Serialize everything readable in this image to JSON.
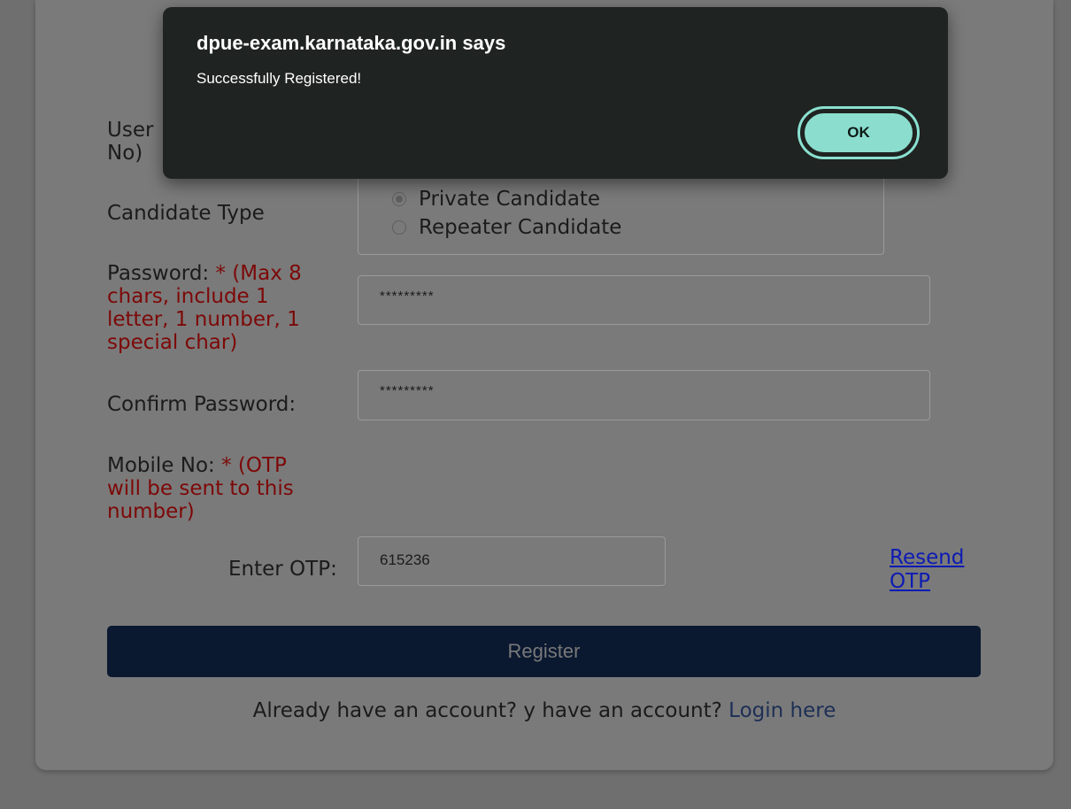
{
  "dialog": {
    "title": "dpue-exam.karnataka.gov.in says",
    "message": "Successfully Registered!",
    "ok_label": "OK"
  },
  "form": {
    "user_label_line1": "User",
    "user_label_line2": "No)",
    "candidate_type_label": "Candidate Type",
    "candidate_options": [
      {
        "label": "Private Candidate",
        "selected": true
      },
      {
        "label": "Repeater Candidate",
        "selected": false
      }
    ],
    "password_label": "Password:",
    "password_hint_line1": "* (Max 8",
    "password_hint_line2": "chars, include 1",
    "password_hint_line3": "letter, 1 number, 1",
    "password_hint_line4": "special char)",
    "password_value": "*********",
    "confirm_password_label": "Confirm Password:",
    "confirm_password_value": "*********",
    "mobile_label": "Mobile No:",
    "mobile_hint_line1": "* (OTP",
    "mobile_hint_line2": "will be sent to this",
    "mobile_hint_line3": "number)",
    "otp_label": "Enter OTP:",
    "otp_value": "615236",
    "resend_line1": "Resend",
    "resend_line2": "OTP",
    "register_label": "Register",
    "footer_text": "Already have an account? y have an account?",
    "login_link": "Login here"
  },
  "colors": {
    "required_hint": "#7d0808",
    "register_button": "#0a1830",
    "ok_button": "#8bdece",
    "dialog_bg": "#1f2321"
  }
}
